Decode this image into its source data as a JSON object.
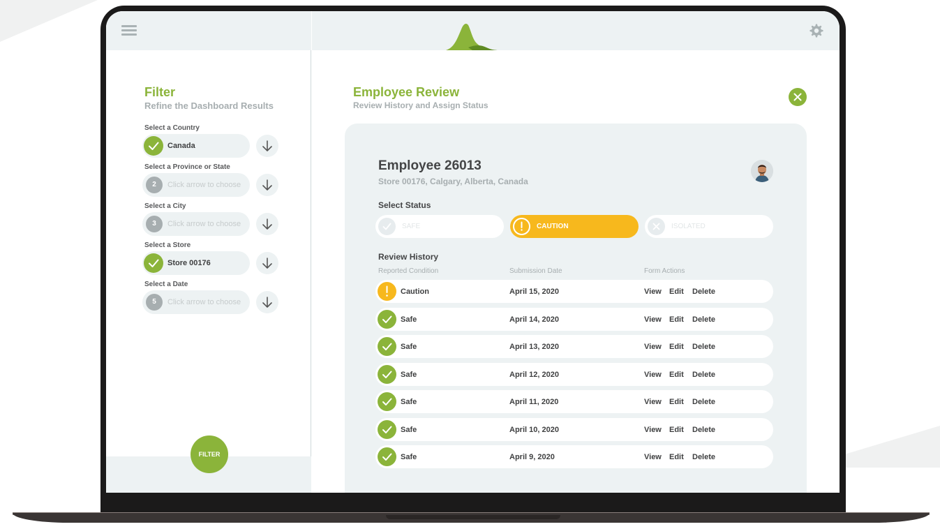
{
  "sidebar": {
    "title": "Filter",
    "subtitle": "Refine the Dashboard Results",
    "filters": [
      {
        "label": "Select a Country",
        "badge": "",
        "value": "Canada",
        "selected": true
      },
      {
        "label": "Select a Province or State",
        "badge": "2",
        "value": "Click arrow to choose",
        "selected": false
      },
      {
        "label": "Select a City",
        "badge": "3",
        "value": "Click arrow to choose",
        "selected": false
      },
      {
        "label": "Select a Store",
        "badge": "",
        "value": "Store 00176",
        "selected": true
      },
      {
        "label": "Select a Date",
        "badge": "5",
        "value": "Click arrow to choose",
        "selected": false
      }
    ],
    "filter_button": "FILTER"
  },
  "header": {
    "title": "Employee Review",
    "subtitle": "Review History and Assign Status"
  },
  "employee": {
    "name": "Employee 26013",
    "store": "Store 00176, Calgary, Alberta, Canada",
    "select_status_label": "Select Status",
    "statuses": [
      "SAFE",
      "CAUTION",
      "ISOLATED"
    ],
    "active_status": "CAUTION"
  },
  "review": {
    "title": "Review History",
    "columns": [
      "Reported Condition",
      "Submission Date",
      "Form Actions"
    ],
    "actions": [
      "View",
      "Edit",
      "Delete"
    ],
    "rows": [
      {
        "condition": "Caution",
        "date": "April 15, 2020"
      },
      {
        "condition": "Safe",
        "date": "April 14, 2020"
      },
      {
        "condition": "Safe",
        "date": "April 13, 2020"
      },
      {
        "condition": "Safe",
        "date": "April 12, 2020"
      },
      {
        "condition": "Safe",
        "date": "April 11, 2020"
      },
      {
        "condition": "Safe",
        "date": "April 10, 2020"
      },
      {
        "condition": "Safe",
        "date": "April 9, 2020"
      }
    ]
  },
  "colors": {
    "accent_green": "#8bb43a",
    "caution_yellow": "#f7b81d",
    "panel_bg": "#edf2f3"
  },
  "icons": [
    "menu-icon",
    "gear-icon",
    "close-icon",
    "check-icon",
    "exclamation-icon",
    "x-icon",
    "arrow-down-icon",
    "logo-icon",
    "avatar"
  ]
}
